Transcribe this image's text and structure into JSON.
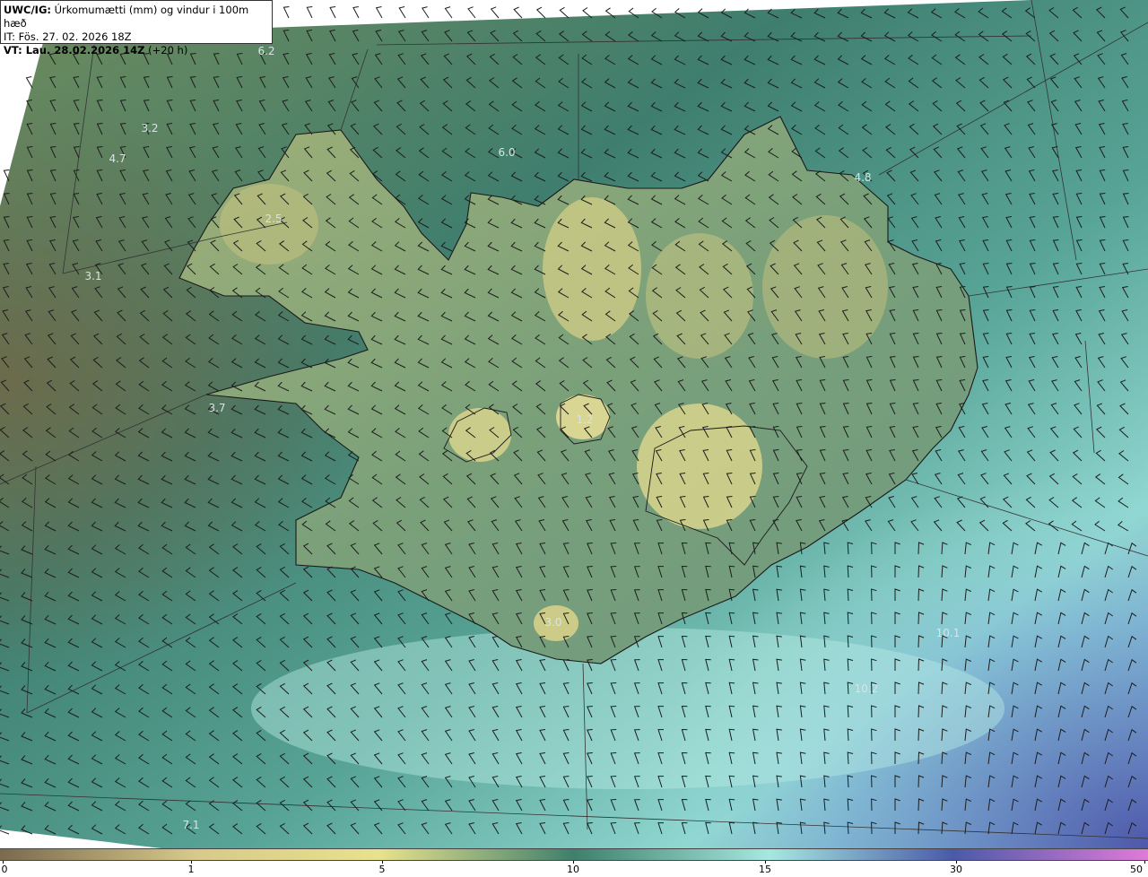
{
  "header": {
    "model_label": "UWC/IG:",
    "title": "Úrkomumætti (mm) og vindur i 100m hæð",
    "init_time": "IT: Fös. 27. 02. 2026 18Z",
    "valid_label": "VT: Lau. 28.02.2026 14Z",
    "lead_time": "(+20 h)"
  },
  "colorbar": {
    "ticks": [
      "0",
      "1",
      "5",
      "10",
      "15",
      "30",
      "50"
    ],
    "colors": [
      "#7a6a4e",
      "#d8c98a",
      "#e8e28c",
      "#3f7f6c",
      "#a6e8e0",
      "#4a5aa8",
      "#e07ad8"
    ]
  },
  "map_values": [
    {
      "id": "v1",
      "text": "6.2"
    },
    {
      "id": "v2",
      "text": "3.2"
    },
    {
      "id": "v3",
      "text": "4.7"
    },
    {
      "id": "v4",
      "text": "6.0"
    },
    {
      "id": "v5",
      "text": "4.8"
    },
    {
      "id": "v6",
      "text": "2.5"
    },
    {
      "id": "v7",
      "text": "3.1"
    },
    {
      "id": "v8",
      "text": "3.7"
    },
    {
      "id": "v9",
      "text": "1.2"
    },
    {
      "id": "v10",
      "text": "3.0"
    },
    {
      "id": "v11",
      "text": "10.1"
    },
    {
      "id": "v12",
      "text": "10.2"
    },
    {
      "id": "v13",
      "text": "7.1"
    }
  ]
}
